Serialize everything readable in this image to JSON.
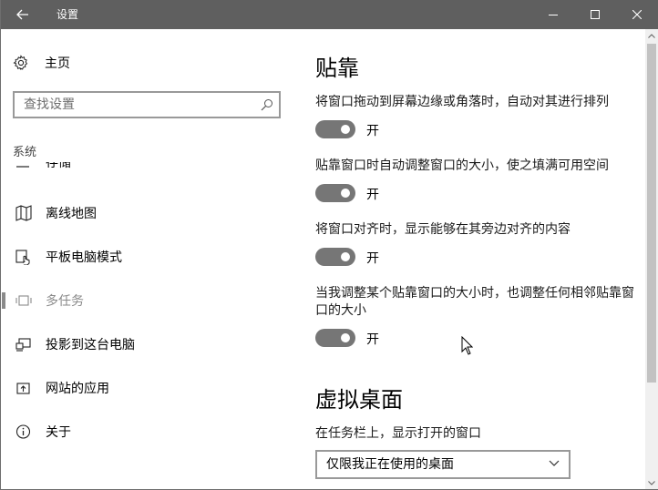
{
  "window": {
    "title": "设置"
  },
  "nav": {
    "home_label": "主页",
    "search_placeholder": "查找设置",
    "group_label": "系统",
    "items": [
      {
        "label": "存储",
        "icon": "storage-icon"
      },
      {
        "label": "离线地图",
        "icon": "map-icon"
      },
      {
        "label": "平板电脑模式",
        "icon": "tablet-mode-icon"
      },
      {
        "label": "多任务",
        "icon": "multitasking-icon",
        "selected": true
      },
      {
        "label": "投影到这台电脑",
        "icon": "project-icon"
      },
      {
        "label": "网站的应用",
        "icon": "apps-for-websites-icon"
      },
      {
        "label": "关于",
        "icon": "info-icon"
      }
    ]
  },
  "content": {
    "snap_heading": "贴靠",
    "settings": [
      {
        "description": "将窗口拖动到屏幕边缘或角落时，自动对其进行排列",
        "state": "开",
        "on": true
      },
      {
        "description": "贴靠窗口时自动调整窗口的大小，使之填满可用空间",
        "state": "开",
        "on": true
      },
      {
        "description": "将窗口对齐时，显示能够在其旁边对齐的内容",
        "state": "开",
        "on": true
      },
      {
        "description": "当我调整某个贴靠窗口的大小时，也调整任何相邻贴靠窗口的大小",
        "state": "开",
        "on": true
      }
    ],
    "virtual_desktop_heading": "虚拟桌面",
    "taskbar_label": "在任务栏上，显示打开的窗口",
    "taskbar_select_value": "仅限我正在使用的桌面"
  },
  "colors": {
    "titlebar": "#5f5f5f",
    "toggle_on": "#767676",
    "selected_text": "#8a8a8a"
  }
}
